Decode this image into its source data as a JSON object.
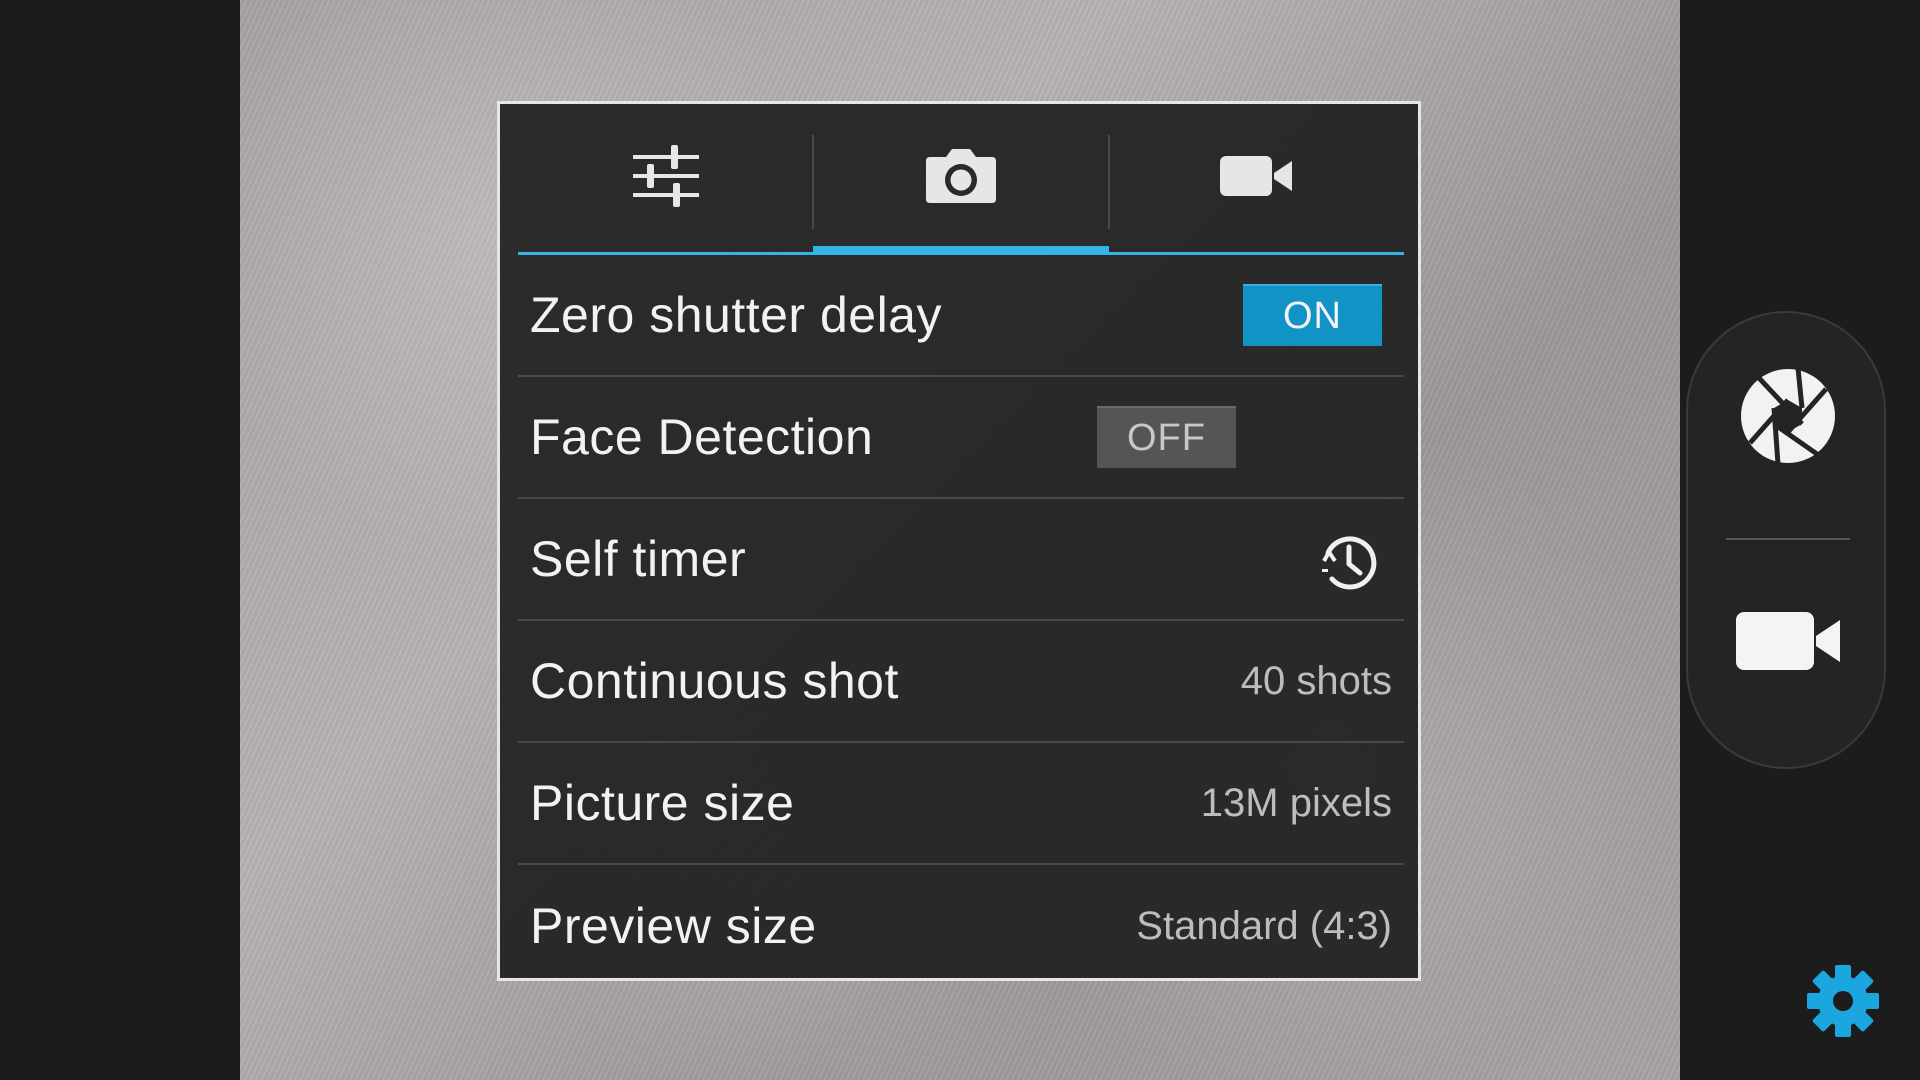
{
  "tabs": [
    {
      "name": "general-settings",
      "icon": "sliders-icon",
      "active": false
    },
    {
      "name": "camera-settings",
      "icon": "camera-icon",
      "active": true
    },
    {
      "name": "video-settings",
      "icon": "video-camera-icon",
      "active": false
    }
  ],
  "settings": {
    "zero_shutter_delay": {
      "label": "Zero shutter delay",
      "value": "ON"
    },
    "face_detection": {
      "label": "Face Detection",
      "value": "OFF"
    },
    "self_timer": {
      "label": "Self timer",
      "icon": "timer-icon"
    },
    "continuous_shot": {
      "label": "Continuous shot",
      "value": "40 shots"
    },
    "picture_size": {
      "label": "Picture size",
      "value": "13M pixels"
    },
    "preview_size": {
      "label": "Preview size",
      "value": "Standard (4:3)"
    }
  },
  "controls": {
    "shutter_icon": "shutter-aperture-icon",
    "video_icon": "video-record-icon",
    "settings_icon": "gear-icon"
  },
  "colors": {
    "accent": "#33b5e5",
    "toggle_on": "#1193c5",
    "toggle_off": "#555555",
    "settings_gear": "#1ba6e0"
  }
}
